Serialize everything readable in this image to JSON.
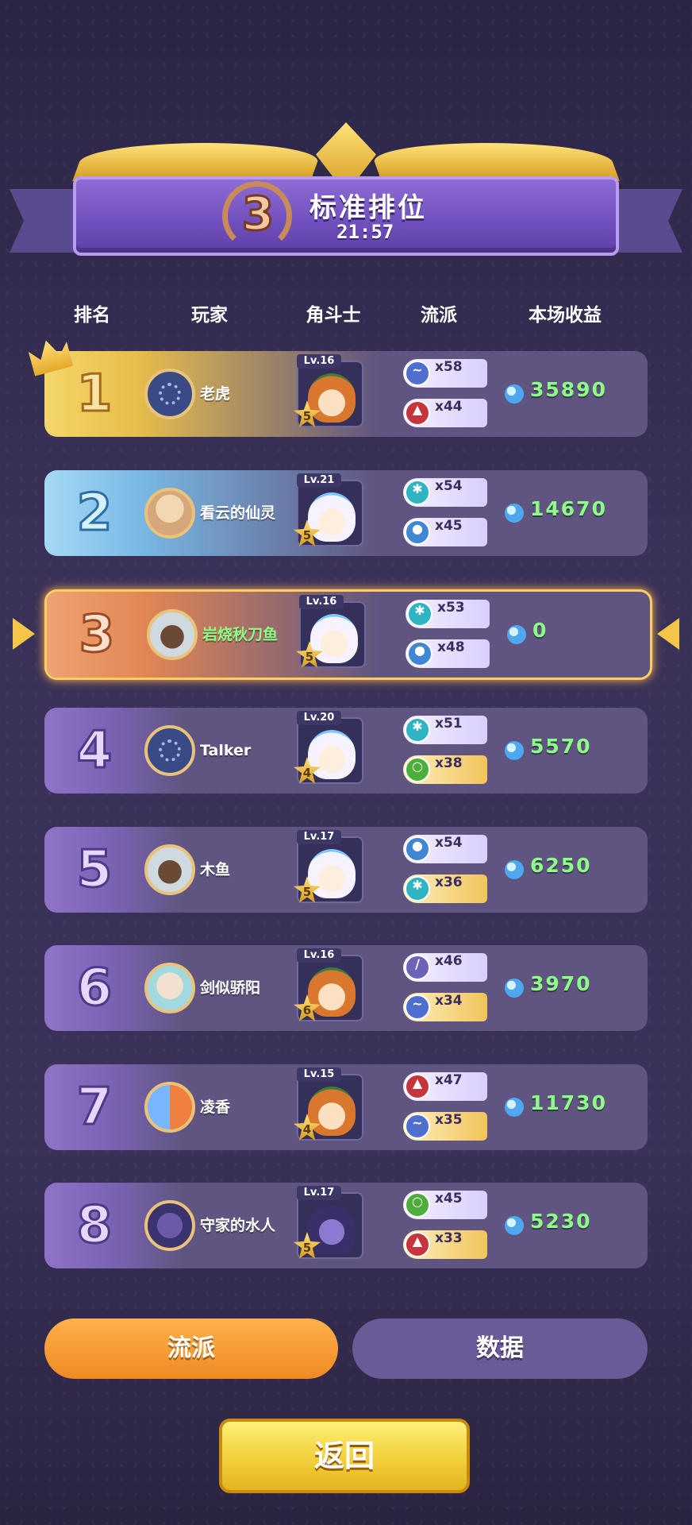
{
  "header": {
    "rank": "3",
    "mode": "标准排位",
    "timer": "21:57"
  },
  "columns": {
    "rank": "排名",
    "player": "玩家",
    "fighter": "角斗士",
    "faction": "流派",
    "income": "本场收益"
  },
  "rows": [
    {
      "rank": "1",
      "player": "老虎",
      "level": "Lv.16",
      "star": "5",
      "hero": "fox",
      "avatar": "load",
      "f1": {
        "icon": "blue-spirit-icon",
        "count": "x58"
      },
      "f2": {
        "icon": "red-flame-icon",
        "count": "x44"
      },
      "income": "35890"
    },
    {
      "rank": "2",
      "player": "看云的仙灵",
      "level": "Lv.21",
      "star": "5",
      "hero": "ice",
      "avatar": "a",
      "f1": {
        "icon": "ice-snowflake-icon",
        "count": "x54"
      },
      "f2": {
        "icon": "water-drop-icon",
        "count": "x45"
      },
      "income": "14670"
    },
    {
      "rank": "3",
      "player": "岩烧秋刀鱼",
      "level": "Lv.16",
      "star": "5",
      "hero": "ice",
      "avatar": "b",
      "f1": {
        "icon": "ice-snowflake-icon",
        "count": "x53"
      },
      "f2": {
        "icon": "water-drop-icon",
        "count": "x48"
      },
      "income": "0"
    },
    {
      "rank": "4",
      "player": "Talker",
      "level": "Lv.20",
      "star": "4",
      "hero": "ice",
      "avatar": "load",
      "f1": {
        "icon": "ice-snowflake-icon",
        "count": "x51"
      },
      "f2": {
        "icon": "green-potion-icon",
        "count": "x38"
      },
      "income": "5570"
    },
    {
      "rank": "5",
      "player": "木鱼",
      "level": "Lv.17",
      "star": "5",
      "hero": "ice",
      "avatar": "b",
      "f1": {
        "icon": "water-drop-icon",
        "count": "x54"
      },
      "f2": {
        "icon": "ice-snowflake-icon",
        "count": "x36"
      },
      "income": "6250"
    },
    {
      "rank": "6",
      "player": "剑似骄阳",
      "level": "Lv.16",
      "star": "6",
      "hero": "fox",
      "avatar": "c",
      "f1": {
        "icon": "sword-icon",
        "count": "x46"
      },
      "f2": {
        "icon": "blue-spirit-icon",
        "count": "x34"
      },
      "income": "3970"
    },
    {
      "rank": "7",
      "player": "凌香",
      "level": "Lv.15",
      "star": "4",
      "hero": "fox",
      "avatar": "d",
      "f1": {
        "icon": "red-flame-icon",
        "count": "x47"
      },
      "f2": {
        "icon": "blue-spirit-icon",
        "count": "x35"
      },
      "income": "11730"
    },
    {
      "rank": "8",
      "player": "守家的水人",
      "level": "Lv.17",
      "star": "5",
      "hero": "dark",
      "avatar": "e",
      "f1": {
        "icon": "green-potion-icon",
        "count": "x45"
      },
      "f2": {
        "icon": "red-flame-icon",
        "count": "x33"
      },
      "income": "5230"
    }
  ],
  "tabs": {
    "faction": "流派",
    "data": "数据"
  },
  "back": "返回"
}
